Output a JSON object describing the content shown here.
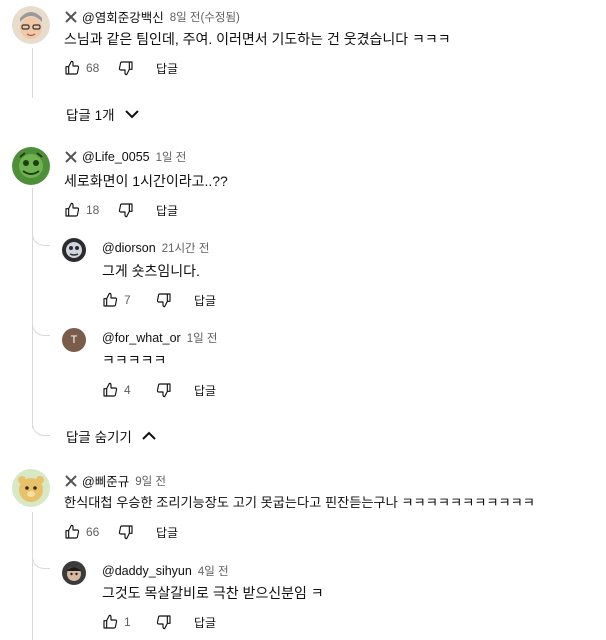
{
  "comments": [
    {
      "handle": "@염회준강백신",
      "time": "8일 전(수정됨)",
      "text": "스님과 같은 팀인데, 주여. 이러면서 기도하는 건 웃겼습니다 ㅋㅋㅋ",
      "likes": "68",
      "reply_label": "답글",
      "toggle_label": "답글 1개"
    },
    {
      "handle": "@Life_0055",
      "time": "1일 전",
      "text": "세로화면이 1시간이라고..??",
      "likes": "18",
      "reply_label": "답글",
      "replies": [
        {
          "handle": "@diorson",
          "time": "21시간 전",
          "text": "그게 숏츠임니다.",
          "likes": "7",
          "reply_label": "답글"
        },
        {
          "handle": "@for_what_or",
          "time": "1일 전",
          "avatar_letter": "T",
          "text": "ㅋㅋㅋㅋㅋ",
          "likes": "4",
          "reply_label": "답글"
        }
      ],
      "toggle_label": "답글 숨기기"
    },
    {
      "handle": "@삐준규",
      "time": "9일 전",
      "text": "한식대첩 우승한 조리기능장도 고기 못굽는다고 핀잔듣는구나 ㅋㅋㅋㅋㅋㅋㅋㅋㅋㅋㅋ",
      "likes": "66",
      "reply_label": "답글",
      "replies": [
        {
          "handle": "@daddy_sihyun",
          "time": "4일 전",
          "text": "그것도 목살갈비로 극찬 받으신분임 ㅋ",
          "likes": "1",
          "reply_label": "답글"
        }
      ]
    }
  ],
  "colors": {
    "text_primary": "#0f0f0f",
    "text_secondary": "#606060",
    "thread_line": "#d9d9d9",
    "avatar_t_bg": "#7a5c4a"
  },
  "icons": {
    "x": "x-icon",
    "like": "thumb-up-icon",
    "dislike": "thumb-down-icon",
    "expand": "chevron-down-icon",
    "collapse": "chevron-up-icon"
  }
}
